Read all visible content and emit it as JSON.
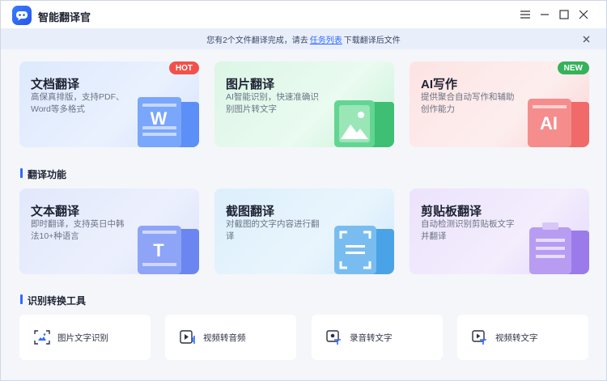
{
  "app": {
    "title": "智能翻译官"
  },
  "notice": {
    "prefix": "您有2个文件翻译完成，请去",
    "link": "任务列表",
    "suffix": "下载翻译后文件"
  },
  "top_cards": [
    {
      "title": "文档翻译",
      "desc": "高保真排版，支持PDF、Word等多格式",
      "badge": "HOT",
      "icon_text": "W"
    },
    {
      "title": "图片翻译",
      "desc": "AI智能识别，快速准确识别图片转文字"
    },
    {
      "title": "AI写作",
      "desc": "提供聚合自动写作和辅助创作能力",
      "badge": "NEW",
      "icon_text": "AI"
    }
  ],
  "sections": {
    "translate": "翻译功能",
    "tools": "识别转换工具"
  },
  "feature_cards": [
    {
      "title": "文本翻译",
      "desc": "即时翻译，支持英日中韩法10+种语言",
      "icon_text": "T"
    },
    {
      "title": "截图翻译",
      "desc": "对截图的文字内容进行翻译"
    },
    {
      "title": "剪贴板翻译",
      "desc": "自动检测识别剪贴板文字并翻译"
    }
  ],
  "tools": [
    {
      "label": "图片文字识别"
    },
    {
      "label": "视频转音频"
    },
    {
      "label": "录音转文字"
    },
    {
      "label": "视频转文字"
    }
  ],
  "colors": {
    "accent": "#2f6bff",
    "hot_badge": "#f2514b",
    "new_badge": "#36b25a"
  }
}
